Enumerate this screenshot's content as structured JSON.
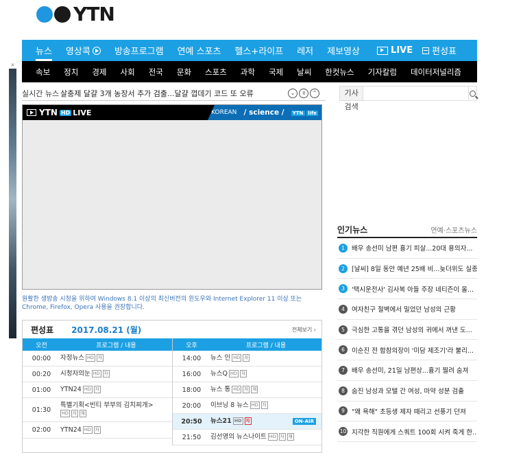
{
  "logo": {
    "word": "YTN"
  },
  "side_ad": {
    "close": "×"
  },
  "nav_main": {
    "items": [
      "뉴스",
      "영상콕",
      "방송프로그램",
      "연예 스포츠",
      "헬스+라이프",
      "레저",
      "제보영상"
    ],
    "live": "LIVE",
    "schedule": "편성표"
  },
  "nav_sub": {
    "items": [
      "속보",
      "정치",
      "경제",
      "사회",
      "전국",
      "문화",
      "스포츠",
      "과학",
      "국제",
      "날씨",
      "한컷뉴스",
      "기자칼럼",
      "데이터저널리즘"
    ]
  },
  "ticker": {
    "label": "실시간 뉴스",
    "text": "살충제 달걀 3개 농장서 추가 검출...달걀 껍데기 코드 또 오류",
    "down": "⌄",
    "pause": "॥",
    "up": "⌃"
  },
  "search": {
    "label": "기사 검색",
    "placeholder": ""
  },
  "player": {
    "brand": "YTN",
    "hd": "HD",
    "live": "LIVE",
    "channels": [
      "KOREAN",
      "/ science /",
      "YTN"
    ],
    "life": "life"
  },
  "notice": "원활한 생방송 시청을 위하여 Windows 8.1 이상의 최신버전의 윈도우와 Internet Explorer 11 이상 또는 Chrome, Firefox, Opera 사용을 권장합니다.",
  "schedule": {
    "title": "편성표",
    "date": "2017.08.21 (월)",
    "more": "전체보기 ›",
    "am_header": "오전",
    "pm_header": "오후",
    "program_header": "프로그램 / 내용",
    "onair": "ON-AIR",
    "am": [
      {
        "time": "00:00",
        "title": "자정뉴스",
        "badges": [
          "HD",
          "자"
        ]
      },
      {
        "time": "00:20",
        "title": "시청자의눈",
        "badges": [
          "HD",
          "자"
        ]
      },
      {
        "time": "01:00",
        "title": "YTN24",
        "badges": [
          "HD",
          "자"
        ]
      },
      {
        "time": "01:30",
        "title": "특별기획<빈티 부부의 김치찌개>",
        "badges": [
          "HD",
          "자",
          "재"
        ]
      },
      {
        "time": "02:00",
        "title": "YTN24",
        "badges": [
          "HD",
          "자"
        ]
      }
    ],
    "pm": [
      {
        "time": "14:00",
        "title": "뉴스 인",
        "badges": [
          "HD",
          "자"
        ]
      },
      {
        "time": "16:00",
        "title": "뉴스Q",
        "badges": [
          "HD",
          "자"
        ]
      },
      {
        "time": "18:00",
        "title": "뉴스 통",
        "badges": [
          "HD",
          "자",
          "재"
        ]
      },
      {
        "time": "20:00",
        "title": "이브닝 8 뉴스",
        "badges": [
          "HD",
          "자"
        ]
      },
      {
        "time": "20:50",
        "title": "뉴스21",
        "badges": [
          "HD",
          "자"
        ]
      },
      {
        "time": "21:50",
        "title": "김선영의 뉴스나이트",
        "badges": [
          "HD",
          "자",
          "재"
        ]
      }
    ]
  },
  "popular": {
    "title": "인기뉴스",
    "tab": "연예·스포츠뉴스",
    "items": [
      "배우 송선미 남편 흉기 피살...20대 용의자...",
      "[날씨] 8일 동안 예년 25배 비...늦더위도 실종",
      "'택시운전사' 김사복 아들 주장 네티즌이 올...",
      "여자친구 절벽에서 밀었던 남성의 근황",
      "극심한 고통을 겪던 남성의 귀에서 꺼낸 도...",
      "이순진 전 합참의장이 '미담 제조기'라 불리...",
      "배우 송선미, 21일 남편상...흉기 찔려 숨져",
      "숨진 남성과 모텔 간 여성, 마약 성분 검출",
      "\"왜 욕해\" 초등생 제자 때리고 선풍기 던져",
      "지각한 직원에게 스쿼트 100회 시켜 죽게 한..."
    ]
  }
}
